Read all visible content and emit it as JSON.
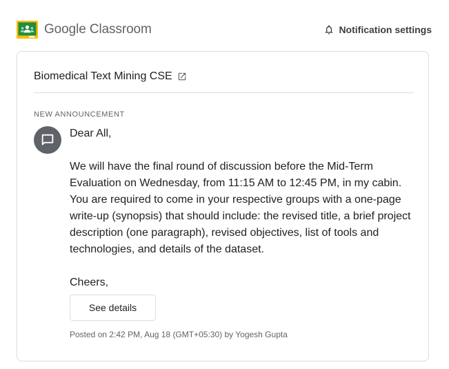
{
  "header": {
    "logo_icon": "google-classroom-logo",
    "app_name": "Google Classroom",
    "notification_icon": "bell-icon",
    "notification_settings_label": "Notification settings"
  },
  "announcement": {
    "class_name": "Biomedical Text Mining CSE",
    "class_link_icon": "open-in-new-icon",
    "section_label": "NEW ANNOUNCEMENT",
    "avatar_icon": "announcement-icon",
    "greeting": "Dear All,",
    "message": "We will have the final round of discussion before the Mid-Term Evaluation on Wednesday, from 11:15 AM to 12:45 PM, in my cabin. You are required to come in your respective groups with a one-page write-up (synopsis) that should include: the revised title, a brief project description (one paragraph), revised objectives, list of tools and technologies, and details of the dataset.",
    "closing": "Cheers,",
    "details_button_label": "See details",
    "posted_info": "Posted on 2:42 PM, Aug 18 (GMT+05:30) by Yogesh Gupta"
  },
  "colors": {
    "logo_green": "#1e8e3e",
    "logo_yellow": "#fbbc04",
    "text_primary": "#202124",
    "text_secondary": "#5f6368",
    "border": "#dadce0",
    "avatar_bg": "#5f6368"
  }
}
